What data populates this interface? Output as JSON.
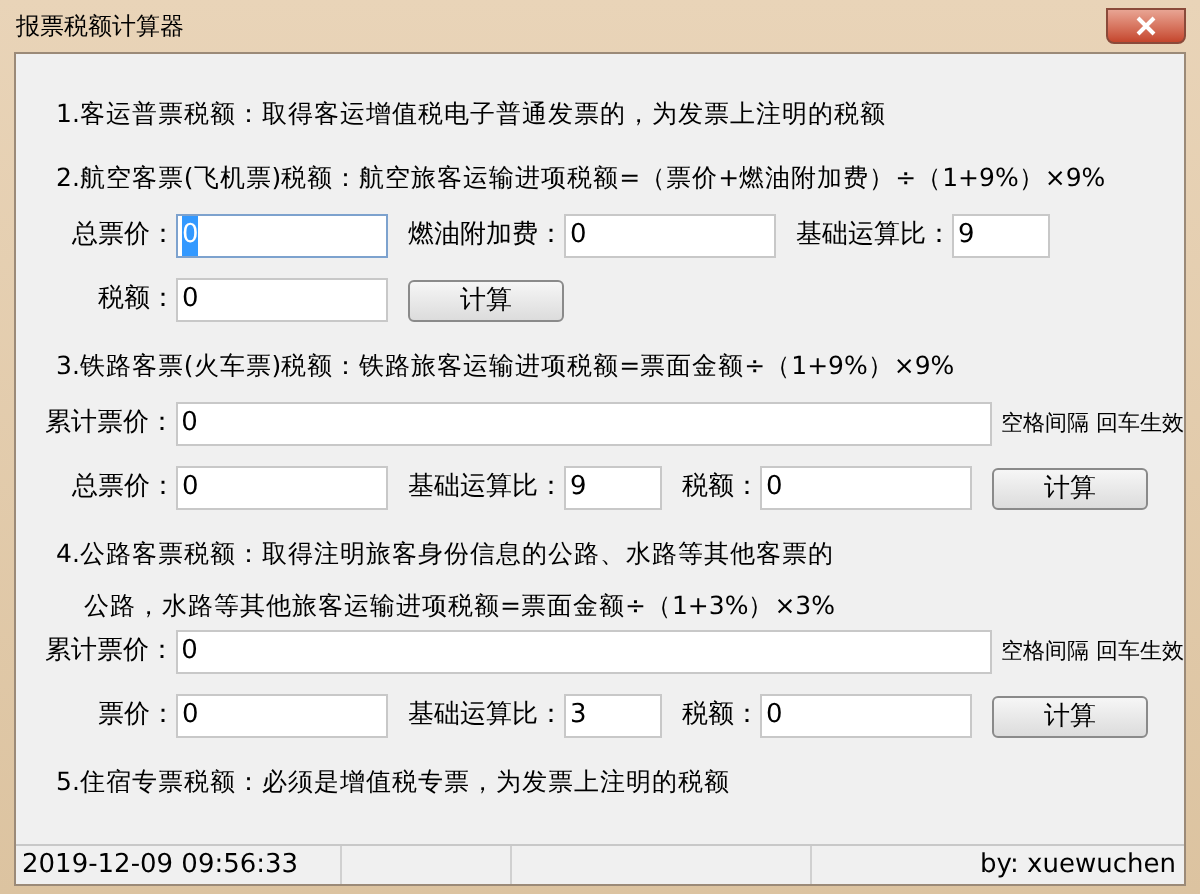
{
  "window": {
    "title": "报票税额计算器"
  },
  "sections": [
    {
      "kind": "note",
      "lines": [
        "1.客运普票税额：取得客运增值税电子普通发票的，为发票上注明的税额"
      ]
    },
    {
      "kind": "calc",
      "lines": [
        "2.航空客票(飞机票)税额：航空旅客运输进项税额=（票价+燃油附加费）÷（1+9%）×9%"
      ],
      "rows": [
        [
          {
            "kind": "field",
            "label": "总票价：",
            "value": "0",
            "focused": true
          },
          {
            "kind": "field",
            "label": "燃油附加费：",
            "value": "0",
            "focused": false
          },
          {
            "kind": "small_field",
            "label": "基础运算比：",
            "value": "9",
            "focused": false
          }
        ],
        [
          {
            "kind": "field",
            "label": "税额：",
            "value": "0",
            "focused": false
          },
          {
            "kind": "button",
            "label": "计算",
            "focused": false
          }
        ]
      ]
    },
    {
      "kind": "calc",
      "lines": [
        "3.铁路客票(火车票)税额：铁路旅客运输进项税额=票面金额÷（1+9%）×9%"
      ],
      "rows": [
        [
          {
            "kind": "long_field",
            "label": "累计票价：",
            "value": "0",
            "hint": "空格间隔 回车生效",
            "focused": false
          }
        ],
        [
          {
            "kind": "field",
            "label": "总票价：",
            "value": "0",
            "focused": false
          },
          {
            "kind": "small_field",
            "label": "基础运算比：",
            "value": "9",
            "focused": false
          },
          {
            "kind": "field",
            "label": "税额：",
            "value": "0",
            "focused": false
          },
          {
            "kind": "button",
            "label": "计算",
            "focused": false
          }
        ]
      ]
    },
    {
      "kind": "calc",
      "lines": [
        "4.公路客票税额：取得注明旅客身份信息的公路、水路等其他客票的",
        "公路，水路等其他旅客运输进项税额=票面金额÷（1+3%）×3%"
      ],
      "rows": [
        [
          {
            "kind": "long_field",
            "label": "累计票价：",
            "value": "0",
            "hint": "空格间隔 回车生效",
            "focused": false
          }
        ],
        [
          {
            "kind": "field",
            "label": "票价：",
            "value": "0",
            "focused": false
          },
          {
            "kind": "small_field",
            "label": "基础运算比：",
            "value": "3",
            "focused": false
          },
          {
            "kind": "field",
            "label": "税额：",
            "value": "0",
            "focused": false
          },
          {
            "kind": "button",
            "label": "计算",
            "focused": false
          }
        ]
      ]
    },
    {
      "kind": "note",
      "lines": [
        "5.住宿专票税额：必须是增值税专票，为发票上注明的税额"
      ]
    }
  ],
  "status_bar": {
    "time": "2019-12-09 09:56:33",
    "author": "by: xuewuchen"
  }
}
